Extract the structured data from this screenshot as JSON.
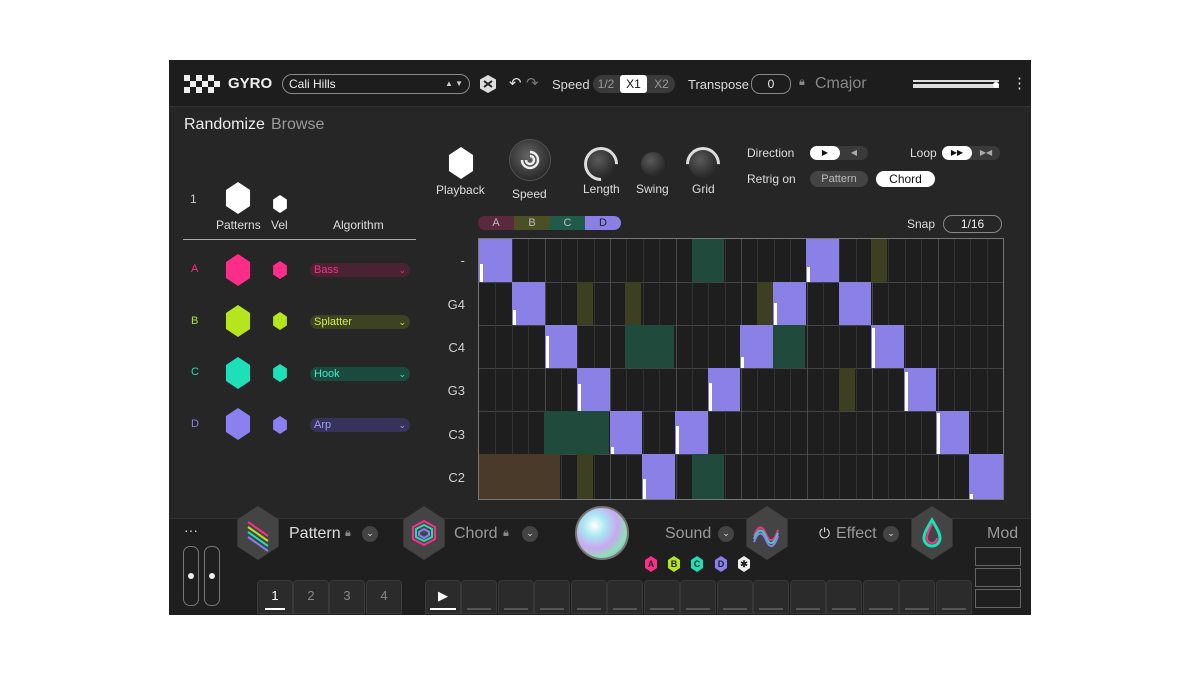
{
  "header": {
    "logo_text": "GYRO",
    "preset_name": "Cali Hills",
    "speed_label": "Speed",
    "speed_options": [
      "1/2",
      "X1",
      "X2"
    ],
    "speed_selected": "X1",
    "transpose_label": "Transpose",
    "transpose_value": "0",
    "key": "Cmajor",
    "menu_glyph": "⋮"
  },
  "tabs": {
    "randomize": "Randomize",
    "browse": "Browse"
  },
  "controls": {
    "playback": "Playback",
    "speed": "Speed",
    "length": "Length",
    "swing": "Swing",
    "grid": "Grid",
    "direction_label": "Direction",
    "loop_label": "Loop",
    "retrig_label": "Retrig on",
    "retrig_options": [
      "Pattern",
      "Chord"
    ],
    "retrig_selected": "Chord",
    "snap_label": "Snap",
    "snap_value": "1/16"
  },
  "patterns": {
    "count": "1",
    "patterns_label": "Patterns",
    "vel_label": "Vel",
    "algorithm_label": "Algorithm",
    "rows": [
      {
        "letter": "A",
        "algorithm": "Bass",
        "color": "#ff2d8a"
      },
      {
        "letter": "B",
        "algorithm": "Splatter",
        "color": "#b5e61d"
      },
      {
        "letter": "C",
        "algorithm": "Hook",
        "color": "#1de0b8"
      },
      {
        "letter": "D",
        "algorithm": "Arp",
        "color": "#8a80f0"
      }
    ]
  },
  "sequencer": {
    "segments": [
      "A",
      "B",
      "C",
      "D"
    ],
    "row_labels": [
      "-",
      "G4",
      "C4",
      "G3",
      "C3",
      "C2"
    ],
    "colors": {
      "note": "#8a80e6",
      "ghost_green": "#1f4a3c",
      "ghost_olive": "#3d3f22",
      "ghost_brown": "#4a3a2a"
    }
  },
  "bottom": {
    "pattern_label": "Pattern",
    "chord_label": "Chord",
    "sound_label": "Sound",
    "effect_label": "Effect",
    "mod_label": "Mod",
    "dots": "···",
    "pattern_tabs": [
      "1",
      "2",
      "3",
      "4"
    ],
    "play_glyph": "▶",
    "slot_hexes": [
      "A",
      "B",
      "C",
      "D"
    ]
  }
}
